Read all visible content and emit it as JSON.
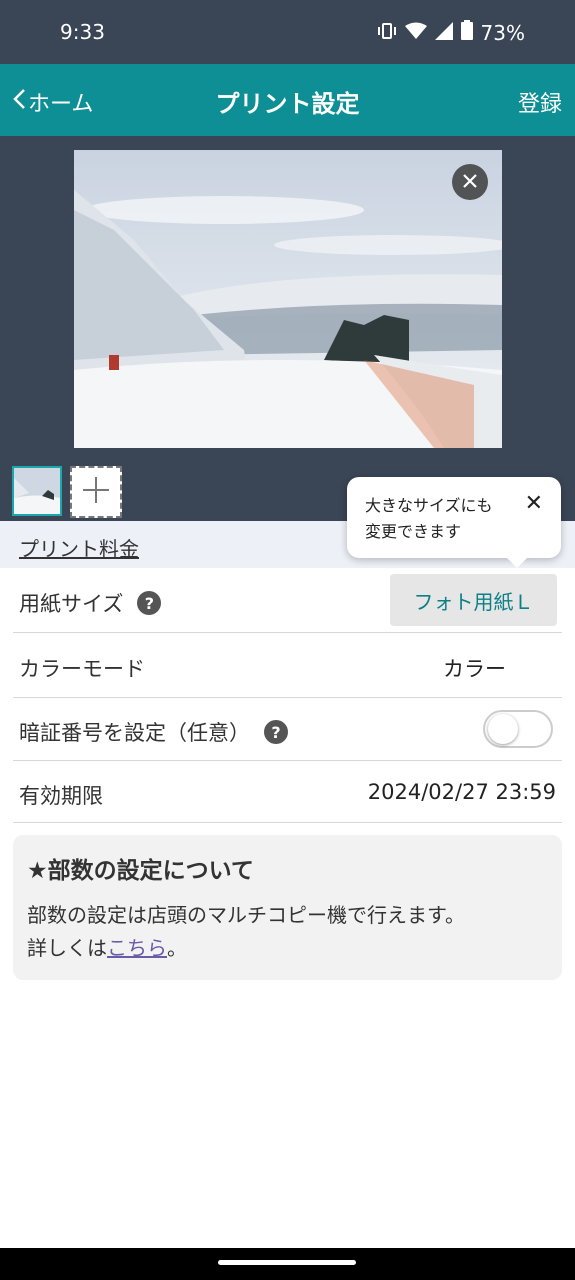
{
  "status_bar": {
    "time": "9:33",
    "battery": "73%"
  },
  "header": {
    "back_label": "ホーム",
    "title": "プリント設定",
    "register_label": "登録"
  },
  "price_bar": {
    "label": "プリント料金"
  },
  "tooltip": {
    "line1": "大きなサイズにも",
    "line2": "変更できます",
    "close": "✕"
  },
  "settings": {
    "paper_size": {
      "label": "用紙サイズ",
      "value": "フォト用紙Ｌ"
    },
    "color_mode": {
      "label": "カラーモード",
      "value": "カラー"
    },
    "pin": {
      "label": "暗証番号を設定（任意）",
      "enabled": false
    },
    "expiry": {
      "label": "有効期限",
      "value": "2024/02/27 23:59"
    }
  },
  "notice": {
    "title": "★部数の設定について",
    "body1": "部数の設定は店頭のマルチコピー機で行えます。",
    "body2_prefix": "詳しくは",
    "body2_link": "こちら",
    "body2_suffix": "。"
  },
  "colors": {
    "header": "#0d8f95",
    "preview_bg": "#3a4555",
    "accent_text": "#0d7f86"
  }
}
